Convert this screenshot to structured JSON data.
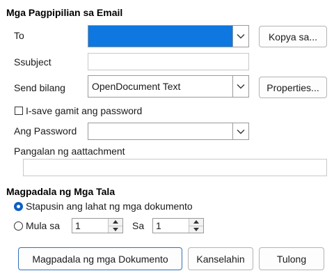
{
  "email_options": {
    "heading": "Mga Pagpipilian sa Email",
    "to_label": "To",
    "to_value": "",
    "copy_button": "Kopya sa...",
    "subject_label": "Ssubject",
    "subject_value": "",
    "send_as_label": "Send bilang",
    "send_as_value": "OpenDocument Text",
    "properties_button": "Properties...",
    "save_password_label": "I-save gamit ang password",
    "password_label": "Ang Password",
    "password_value": "",
    "attachment_label": "Pangalan ng aattachment",
    "attachment_value": ""
  },
  "send_records": {
    "heading": "Magpadala ng Mga Tala",
    "all_docs_label": "Stapusin ang lahat ng mga dokumento",
    "from_label": "Mula sa",
    "from_value": "1",
    "to_label": "Sa",
    "to_value": "1"
  },
  "buttons": {
    "send": "Magpadala ng mga Dokumento",
    "cancel": "Kanselahin",
    "help": "Tulong"
  },
  "colors": {
    "accent": "#0e5fc4",
    "selected_field": "#0e78e0"
  },
  "icons": {
    "dropdown": "chevron-down-icon",
    "spin_up": "spin-up-icon",
    "spin_down": "spin-down-icon"
  }
}
